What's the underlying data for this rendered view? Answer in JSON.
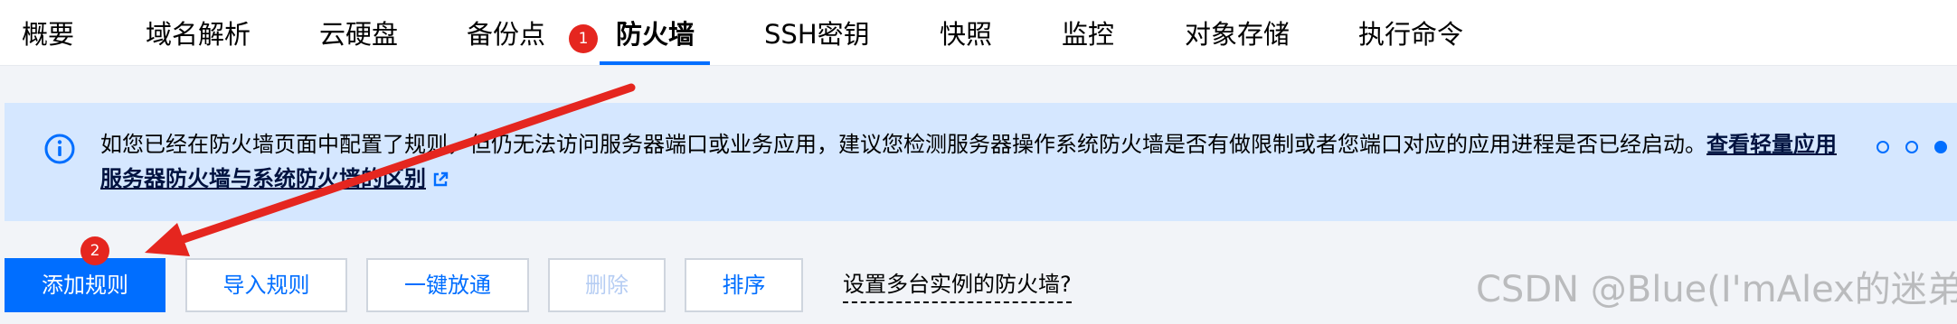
{
  "tabs": [
    {
      "label": "概要"
    },
    {
      "label": "域名解析"
    },
    {
      "label": "云硬盘"
    },
    {
      "label": "备份点"
    },
    {
      "label": "防火墙"
    },
    {
      "label": "SSH密钥"
    },
    {
      "label": "快照"
    },
    {
      "label": "监控"
    },
    {
      "label": "对象存储"
    },
    {
      "label": "执行命令"
    }
  ],
  "active_tab": "防火墙",
  "annotations": {
    "step1": "1",
    "step2": "2",
    "marker_color": "#e5261f"
  },
  "notice": {
    "text": "如您已经在防火墙页面中配置了规则，但仍无法访问服务器端口或业务应用，建议您检测服务器操作系统防火墙是否有做限制或者您端口对应的应用进程是否已经启动。",
    "link": "查看轻量应用服务器防火墙与系统防火墙的区别",
    "icon": "info-icon",
    "link_icon": "external-link-icon",
    "pager_count": 3,
    "pager_active": 3
  },
  "toolbar": {
    "add_rule": "添加规则",
    "import_rule": "导入规则",
    "one_click_open": "一键放通",
    "delete": "删除",
    "sort": "排序",
    "multi_instance_link": "设置多台实例的防火墙?"
  },
  "watermark": "CSDN @Blue(I'mAlex的迷弟)",
  "colors": {
    "accent": "#006eff",
    "notice_bg": "#d5e7ff",
    "page_bg": "#f2f4f8"
  }
}
